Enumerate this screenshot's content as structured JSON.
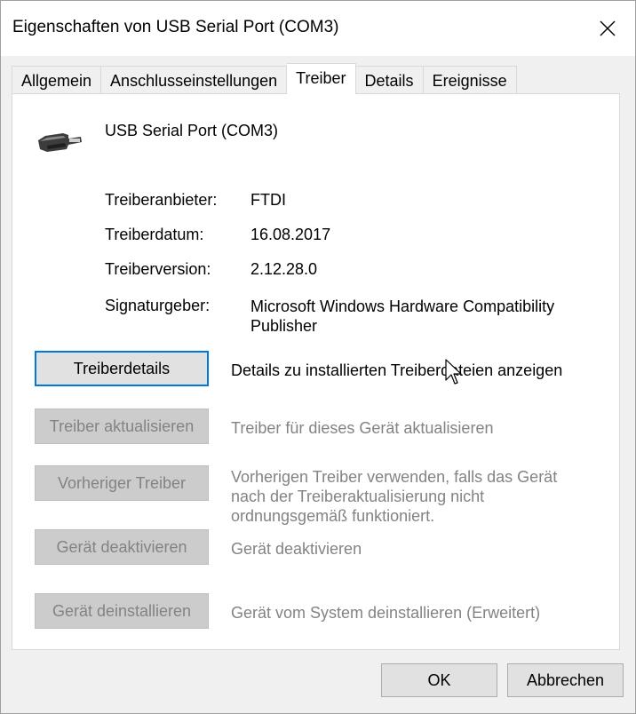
{
  "window": {
    "title": "Eigenschaften von USB Serial Port (COM3)"
  },
  "tabs": [
    {
      "label": "Allgemein"
    },
    {
      "label": "Anschlusseinstellungen"
    },
    {
      "label": "Treiber"
    },
    {
      "label": "Details"
    },
    {
      "label": "Ereignisse"
    }
  ],
  "device": {
    "name": "USB Serial Port (COM3)",
    "icon": "usb-connector-icon"
  },
  "info": [
    {
      "label": "Treiberanbieter:",
      "value": "FTDI"
    },
    {
      "label": "Treiberdatum:",
      "value": "16.08.2017"
    },
    {
      "label": "Treiberversion:",
      "value": "2.12.28.0"
    },
    {
      "label": "Signaturgeber:",
      "value": "Microsoft Windows Hardware Compatibility Publisher"
    }
  ],
  "actions": [
    {
      "label": "Treiberdetails",
      "description": "Details zu installierten Treiberdateien anzeigen",
      "enabled": true
    },
    {
      "label": "Treiber aktualisieren",
      "description": "Treiber für dieses Gerät aktualisieren",
      "enabled": false
    },
    {
      "label": "Vorheriger Treiber",
      "description": "Vorherigen Treiber verwenden, falls das Gerät nach der Treiberaktualisierung nicht ordnungsgemäß funktioniert.",
      "enabled": false
    },
    {
      "label": "Gerät deaktivieren",
      "description": "Gerät deaktivieren",
      "enabled": false
    },
    {
      "label": "Gerät deinstallieren",
      "description": "Gerät vom System deinstallieren (Erweitert)",
      "enabled": false
    }
  ],
  "footer": {
    "ok_label": "OK",
    "cancel_label": "Abbrechen"
  },
  "colors": {
    "focus_border": "#0078d7",
    "disabled_text": "#838383"
  }
}
